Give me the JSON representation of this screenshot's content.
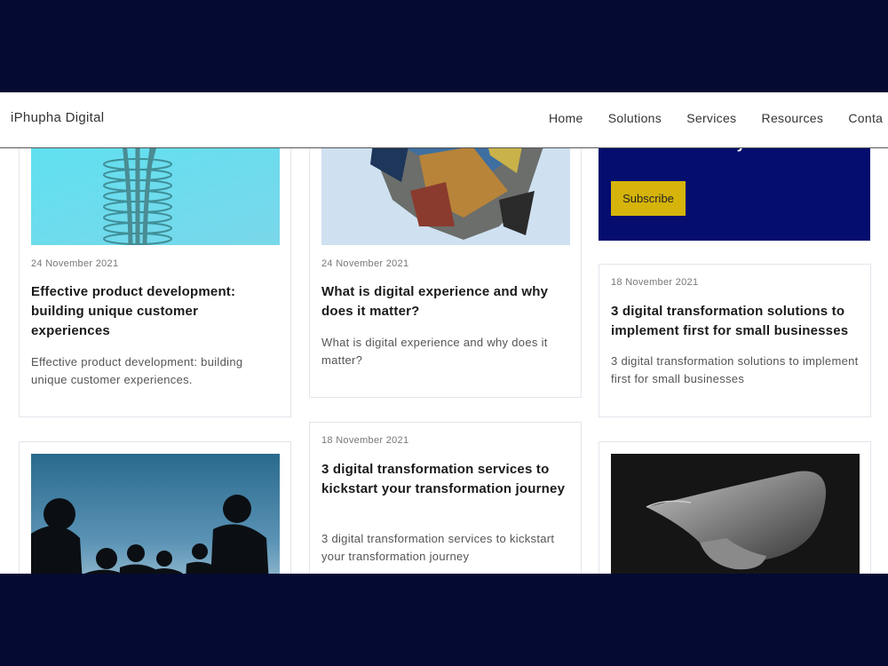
{
  "header": {
    "brand": "iPhupha Digital",
    "nav": [
      "Home",
      "Solutions",
      "Services",
      "Resources",
      "Conta"
    ]
  },
  "promo": {
    "heading": "Never miss a story",
    "button": "Subscribe"
  },
  "posts": [
    {
      "date": "24 November 2021",
      "title": "Effective product development: building unique customer experiences",
      "excerpt": "Effective product development: building unique customer experiences."
    },
    {
      "date": "24 November 2021",
      "title": "What is digital experience and why does it matter?",
      "excerpt": "What is digital experience and why does it matter?"
    },
    {
      "date": "18 November 2021",
      "title": "3 digital transformation solutions to implement first for small businesses",
      "excerpt": "3 digital transformation solutions to implement first for small businesses"
    },
    {
      "date": "18 November 2021",
      "title": "3 digital transformation services to kickstart your transformation journey",
      "excerpt": "3 digital transformation services to kickstart your transformation journey"
    }
  ]
}
